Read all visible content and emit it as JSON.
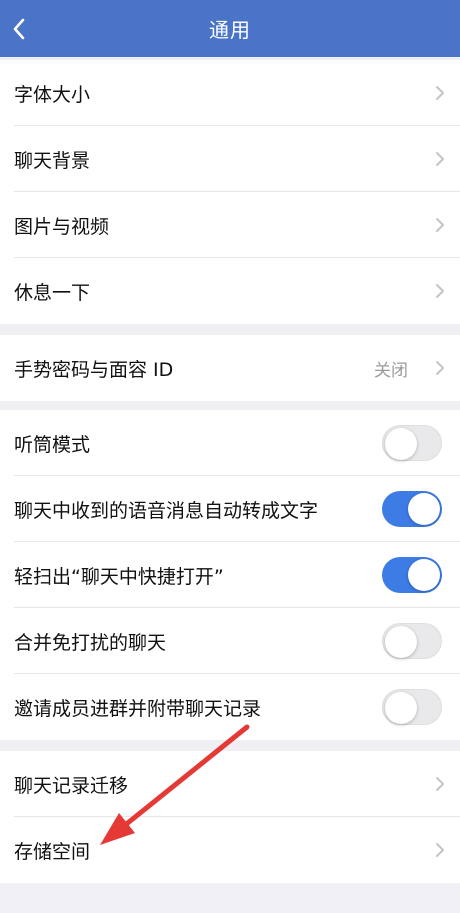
{
  "header": {
    "title": "通用",
    "back_icon": "chevron-left-icon"
  },
  "sections": [
    {
      "items": [
        {
          "label": "字体大小",
          "type": "link"
        },
        {
          "label": "聊天背景",
          "type": "link"
        },
        {
          "label": "图片与视频",
          "type": "link"
        },
        {
          "label": "休息一下",
          "type": "link"
        }
      ]
    },
    {
      "items": [
        {
          "label": "手势密码与面容 ID",
          "type": "link",
          "value": "关闭"
        }
      ]
    },
    {
      "items": [
        {
          "label": "听筒模式",
          "type": "toggle",
          "on": false
        },
        {
          "label": "聊天中收到的语音消息自动转成文字",
          "type": "toggle",
          "on": true
        },
        {
          "label": "轻扫出“聊天中快捷打开”",
          "type": "toggle",
          "on": true
        },
        {
          "label": "合并免打扰的聊天",
          "type": "toggle",
          "on": false
        },
        {
          "label": "邀请成员进群并附带聊天记录",
          "type": "toggle",
          "on": false
        }
      ]
    },
    {
      "items": [
        {
          "label": "聊天记录迁移",
          "type": "link"
        },
        {
          "label": "存储空间",
          "type": "link"
        }
      ]
    }
  ],
  "colors": {
    "nav_bg": "#4a74c7",
    "toggle_on": "#3d7be5",
    "annotation_arrow": "#e53935"
  }
}
